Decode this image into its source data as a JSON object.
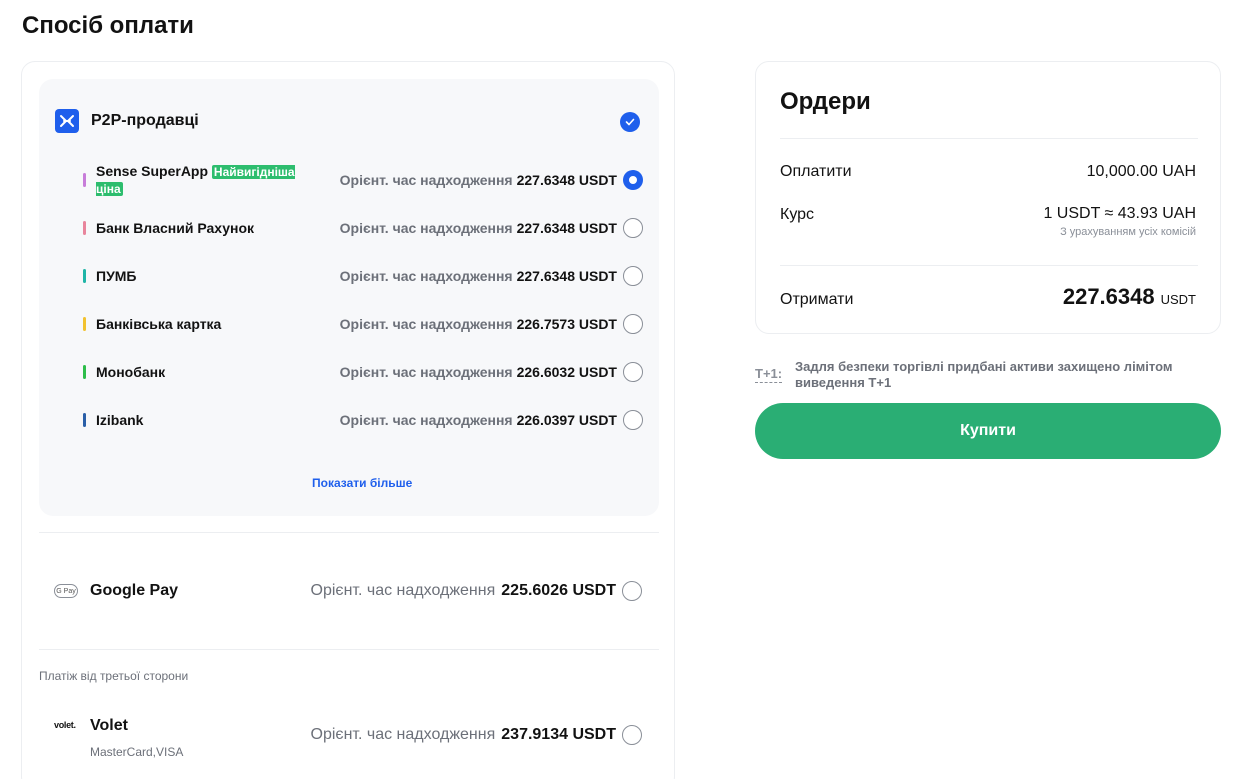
{
  "page_title": "Спосіб оплати",
  "p2p": {
    "title": "P2P-продавці",
    "logo_icon": "p2p-swap-icon",
    "show_more": "Показати більше",
    "sellers": [
      {
        "name": "Sense SuperApp",
        "badge": "Найвигідніша ціна",
        "eta_label": "Орієнт. час надходження",
        "amount": "227.6348 USDT",
        "color": "#c77dd9",
        "selected": true
      },
      {
        "name": "Банк Власний Рахунок",
        "eta_label": "Орієнт. час надходження",
        "amount": "227.6348 USDT",
        "color": "#e8859c",
        "selected": false
      },
      {
        "name": "ПУМБ",
        "eta_label": "Орієнт. час надходження",
        "amount": "227.6348 USDT",
        "color": "#1fb5a7",
        "selected": false
      },
      {
        "name": "Банківська картка",
        "eta_label": "Орієнт. час надходження",
        "amount": "226.7573 USDT",
        "color": "#f2c230",
        "selected": false
      },
      {
        "name": "Монобанк",
        "eta_label": "Орієнт. час надходження",
        "amount": "226.6032 USDT",
        "color": "#2dbd4a",
        "selected": false
      },
      {
        "name": "Izibank",
        "eta_label": "Орієнт. час надходження",
        "amount": "226.0397 USDT",
        "color": "#2a5fa8",
        "selected": false
      }
    ]
  },
  "google_pay": {
    "logo_text": "G Pay",
    "name": "Google Pay",
    "eta_label": "Орієнт. час надходження",
    "amount": "225.6026 USDT"
  },
  "third_party": {
    "label": "Платіж від третьої сторони",
    "volet": {
      "logo_text": "volet.",
      "name": "Volet",
      "sub": "MasterCard,VISA",
      "eta_label": "Орієнт. час надходження",
      "amount": "237.9134 USDT"
    }
  },
  "orders": {
    "title": "Ордери",
    "pay_label": "Оплатити",
    "pay_value": "10,000.00 UAH",
    "rate_label": "Курс",
    "rate_value": "1 USDT ≈ 43.93 UAH",
    "rate_note": "З урахуванням усіх комісій",
    "receive_label": "Отримати",
    "receive_amount": "227.6348",
    "receive_unit": "USDT"
  },
  "notice": {
    "badge": "T+1:",
    "text": "Задля безпеки торгівлі придбані активи захищено лімітом виведення T+1"
  },
  "buy_button": "Купити",
  "colors": {
    "accent_blue": "#1f5fec",
    "buy_green": "#2aae74",
    "badge_green": "#2dbd6e"
  }
}
